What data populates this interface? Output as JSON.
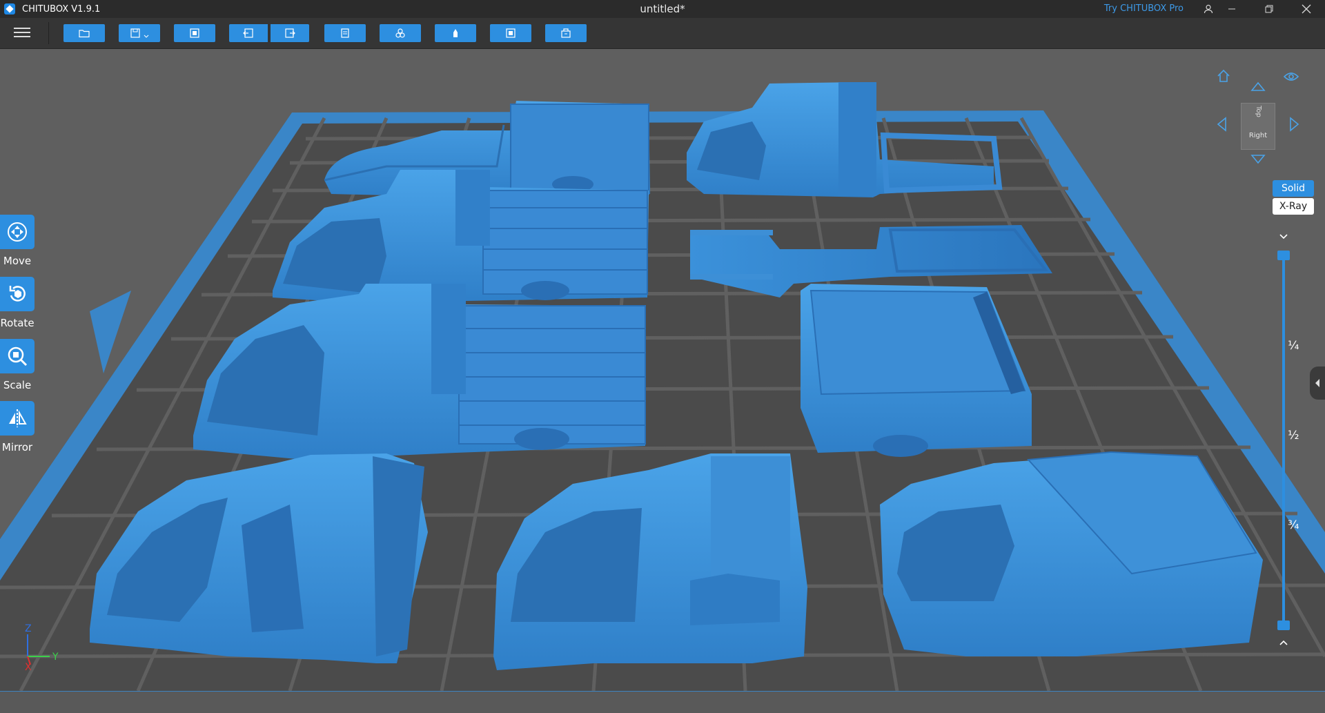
{
  "titlebar": {
    "app_name": "CHITUBOX V1.9.1",
    "document_title": "untitled*",
    "try_pro": "Try CHITUBOX Pro"
  },
  "toolbar": {
    "tools": [
      "open-file",
      "save",
      "auto-arrange",
      "undo",
      "redo",
      "copy",
      "layout",
      "support",
      "hollow",
      "slice"
    ]
  },
  "side_tools": [
    {
      "label": "Move",
      "icon": "move-icon"
    },
    {
      "label": "Rotate",
      "icon": "rotate-icon"
    },
    {
      "label": "Scale",
      "icon": "scale-icon"
    },
    {
      "label": "Mirror",
      "icon": "mirror-icon"
    }
  ],
  "view_cube": {
    "face_label": "Right",
    "top_label": "Top"
  },
  "display_modes": {
    "solid": "Solid",
    "xray": "X-Ray",
    "active": "Solid"
  },
  "layer_slider": {
    "marks": [
      "¼",
      "½",
      "¾"
    ],
    "top_value": 1.0,
    "bottom_value": 0.0
  },
  "axes": {
    "z": "Z",
    "y": "Y",
    "x": "X"
  },
  "colors": {
    "accent": "#2d8fe0",
    "model": "#3d8fd6",
    "platform_edge": "#3a86c8",
    "grid": "#525252",
    "viewport_bg": "#5f5f5f"
  }
}
